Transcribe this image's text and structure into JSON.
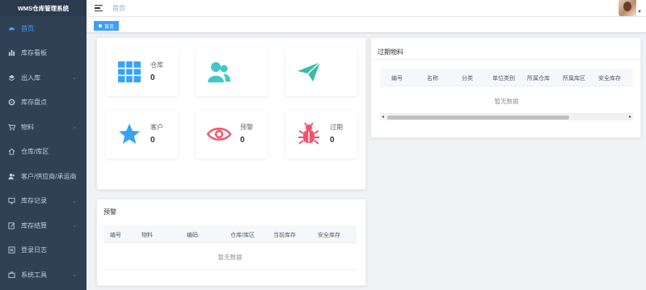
{
  "app": {
    "title": "WMS仓库管理系统"
  },
  "sidebar": {
    "items": [
      {
        "label": "首页",
        "icon": "dashboard-icon",
        "active": true,
        "expandable": false
      },
      {
        "label": "库存看板",
        "icon": "bar-chart-icon",
        "active": false,
        "expandable": false
      },
      {
        "label": "出入库",
        "icon": "layers-icon",
        "active": false,
        "expandable": true
      },
      {
        "label": "库存盘点",
        "icon": "target-icon",
        "active": false,
        "expandable": false
      },
      {
        "label": "物料",
        "icon": "cart-icon",
        "active": false,
        "expandable": true
      },
      {
        "label": "仓库/库区",
        "icon": "home-icon",
        "active": false,
        "expandable": false
      },
      {
        "label": "客户/供应商/承运商",
        "icon": "users-icon",
        "active": false,
        "expandable": false
      },
      {
        "label": "库存记录",
        "icon": "monitor-icon",
        "active": false,
        "expandable": true
      },
      {
        "label": "库存结算",
        "icon": "edit-icon",
        "active": false,
        "expandable": true
      },
      {
        "label": "登录日志",
        "icon": "log-icon",
        "active": false,
        "expandable": false
      },
      {
        "label": "系统工具",
        "icon": "tools-icon",
        "active": false,
        "expandable": true
      }
    ]
  },
  "header": {
    "breadcrumb": "首页"
  },
  "tags": {
    "active_tag": "首页"
  },
  "stats": [
    {
      "label": "仓库",
      "value": "0",
      "icon": "grid-icon",
      "color": "#36a3f7"
    },
    {
      "label": "",
      "value": "",
      "icon": "users-icon",
      "color": "#40c9c6"
    },
    {
      "label": "",
      "value": "",
      "icon": "send-icon",
      "color": "#34bfa3"
    },
    {
      "label": "客户",
      "value": "0",
      "icon": "star-icon",
      "color": "#36a3f7"
    },
    {
      "label": "预警",
      "value": "0",
      "icon": "eye-icon",
      "color": "#f4516c"
    },
    {
      "label": "过期",
      "value": "0",
      "icon": "bug-icon",
      "color": "#f4516c"
    }
  ],
  "expired_panel": {
    "title": "过期物料",
    "columns": [
      "编号",
      "名称",
      "分类",
      "单位类别",
      "所属仓库",
      "所属库区",
      "安全库存"
    ],
    "empty_text": "暂无数据"
  },
  "warning_panel": {
    "title": "预警",
    "columns": [
      "编号",
      "物料",
      "编码",
      "仓库/库区",
      "当前库存",
      "安全库存"
    ],
    "empty_text": "暂无数据"
  }
}
